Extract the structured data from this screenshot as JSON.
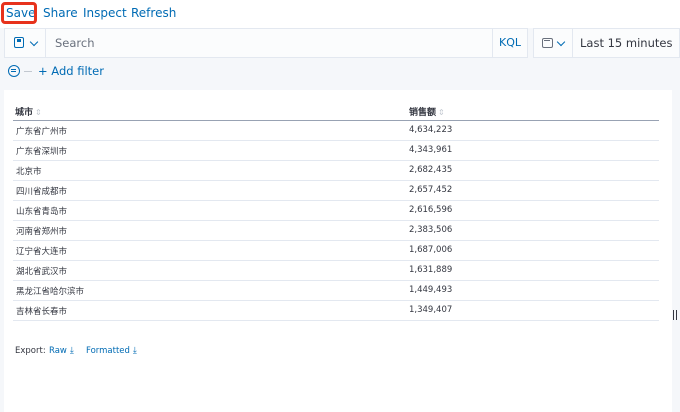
{
  "nav": {
    "save": "Save",
    "share": "Share",
    "inspect": "Inspect",
    "refresh": "Refresh"
  },
  "query": {
    "placeholder": "Search",
    "language": "KQL"
  },
  "time": {
    "label": "Last 15 minutes"
  },
  "filter": {
    "add_label": "+ Add filter"
  },
  "table": {
    "columns": [
      "城市",
      "销售额"
    ],
    "rows": [
      [
        "广东省广州市",
        "4,634,223"
      ],
      [
        "广东省深圳市",
        "4,343,961"
      ],
      [
        "北京市",
        "2,682,435"
      ],
      [
        "四川省成都市",
        "2,657,452"
      ],
      [
        "山东省青岛市",
        "2,616,596"
      ],
      [
        "河南省郑州市",
        "2,383,506"
      ],
      [
        "辽宁省大连市",
        "1,687,006"
      ],
      [
        "湖北省武汉市",
        "1,631,889"
      ],
      [
        "黑龙江省哈尔滨市",
        "1,449,493"
      ],
      [
        "吉林省长春市",
        "1,349,407"
      ]
    ]
  },
  "export": {
    "label": "Export:",
    "raw": "Raw",
    "formatted": "Formatted"
  }
}
